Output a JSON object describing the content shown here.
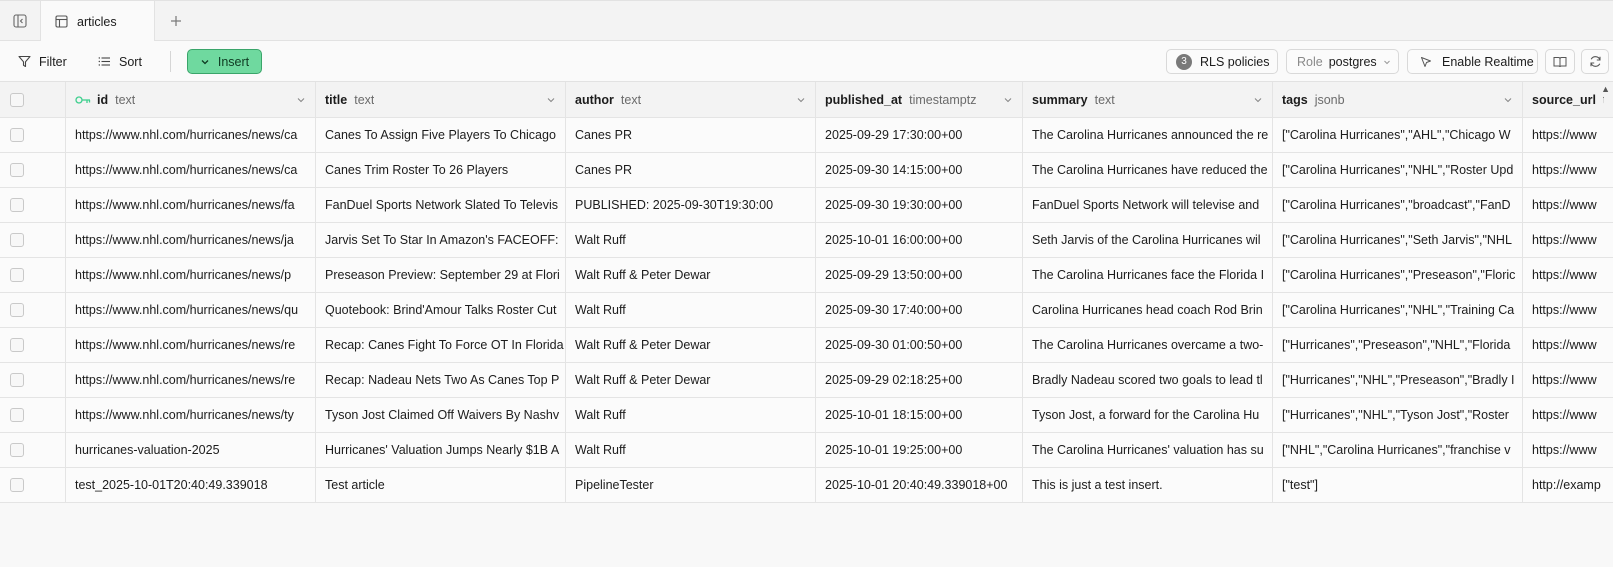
{
  "tab": {
    "label": "articles"
  },
  "toolbar": {
    "filter_label": "Filter",
    "sort_label": "Sort",
    "insert_label": "Insert",
    "rls_count": "3",
    "rls_label": "RLS policies",
    "role_prefix": "Role",
    "role_value": "postgres",
    "realtime_label": "Enable Realtime"
  },
  "columns": [
    {
      "name": "id",
      "type": "text"
    },
    {
      "name": "title",
      "type": "text"
    },
    {
      "name": "author",
      "type": "text"
    },
    {
      "name": "published_at",
      "type": "timestamptz"
    },
    {
      "name": "summary",
      "type": "text"
    },
    {
      "name": "tags",
      "type": "jsonb"
    },
    {
      "name": "source_url",
      "type": "t"
    }
  ],
  "rows": [
    [
      "https://www.nhl.com/hurricanes/news/ca",
      "Canes To Assign Five Players To Chicago",
      "Canes PR",
      "2025-09-29 17:30:00+00",
      "The Carolina Hurricanes announced the re",
      "[\"Carolina Hurricanes\",\"AHL\",\"Chicago W",
      "https://www"
    ],
    [
      "https://www.nhl.com/hurricanes/news/ca",
      "Canes Trim Roster To 26 Players",
      "Canes PR",
      "2025-09-30 14:15:00+00",
      "The Carolina Hurricanes have reduced the",
      "[\"Carolina Hurricanes\",\"NHL\",\"Roster Upd",
      "https://www"
    ],
    [
      "https://www.nhl.com/hurricanes/news/fa",
      "FanDuel Sports Network Slated To Televis",
      "PUBLISHED: 2025-09-30T19:30:00",
      "2025-09-30 19:30:00+00",
      "FanDuel Sports Network will televise and",
      "[\"Carolina Hurricanes\",\"broadcast\",\"FanD",
      "https://www"
    ],
    [
      "https://www.nhl.com/hurricanes/news/ja",
      "Jarvis Set To Star In Amazon's FACEOFF:",
      "Walt Ruff",
      "2025-10-01 16:00:00+00",
      "Seth Jarvis of the Carolina Hurricanes wil",
      "[\"Carolina Hurricanes\",\"Seth Jarvis\",\"NHL",
      "https://www"
    ],
    [
      "https://www.nhl.com/hurricanes/news/p",
      "Preseason Preview: September 29 at Flori",
      "Walt Ruff & Peter Dewar",
      "2025-09-29 13:50:00+00",
      "The Carolina Hurricanes face the Florida I",
      "[\"Carolina Hurricanes\",\"Preseason\",\"Floric",
      "https://www"
    ],
    [
      "https://www.nhl.com/hurricanes/news/qu",
      "Quotebook: Brind'Amour Talks Roster Cut",
      "Walt Ruff",
      "2025-09-30 17:40:00+00",
      "Carolina Hurricanes head coach Rod Brin",
      "[\"Carolina Hurricanes\",\"NHL\",\"Training Ca",
      "https://www"
    ],
    [
      "https://www.nhl.com/hurricanes/news/re",
      "Recap: Canes Fight To Force OT In Florida",
      "Walt Ruff & Peter Dewar",
      "2025-09-30 01:00:50+00",
      "The Carolina Hurricanes overcame a two-",
      "[\"Hurricanes\",\"Preseason\",\"NHL\",\"Florida",
      "https://www"
    ],
    [
      "https://www.nhl.com/hurricanes/news/re",
      "Recap: Nadeau Nets Two As Canes Top P",
      "Walt Ruff & Peter Dewar",
      "2025-09-29 02:18:25+00",
      "Bradly Nadeau scored two goals to lead tl",
      "[\"Hurricanes\",\"NHL\",\"Preseason\",\"Bradly I",
      "https://www"
    ],
    [
      "https://www.nhl.com/hurricanes/news/ty",
      "Tyson Jost Claimed Off Waivers By Nashv",
      "Walt Ruff",
      "2025-10-01 18:15:00+00",
      "Tyson Jost, a forward for the Carolina Hu",
      "[\"Hurricanes\",\"NHL\",\"Tyson Jost\",\"Roster",
      "https://www"
    ],
    [
      "hurricanes-valuation-2025",
      "Hurricanes' Valuation Jumps Nearly $1B A",
      "Walt Ruff",
      "2025-10-01 19:25:00+00",
      "The Carolina Hurricanes' valuation has su",
      "[\"NHL\",\"Carolina Hurricanes\",\"franchise v",
      "https://www"
    ],
    [
      "test_2025-10-01T20:40:49.339018",
      "Test article",
      "PipelineTester",
      "2025-10-01 20:40:49.339018+00",
      "This is just a test insert.",
      "[\"test\"]",
      "http://examp"
    ]
  ],
  "colors": {
    "insert_bg": "#6fd99f",
    "insert_border": "#3aa56a",
    "key_icon": "#3ecf8e"
  }
}
